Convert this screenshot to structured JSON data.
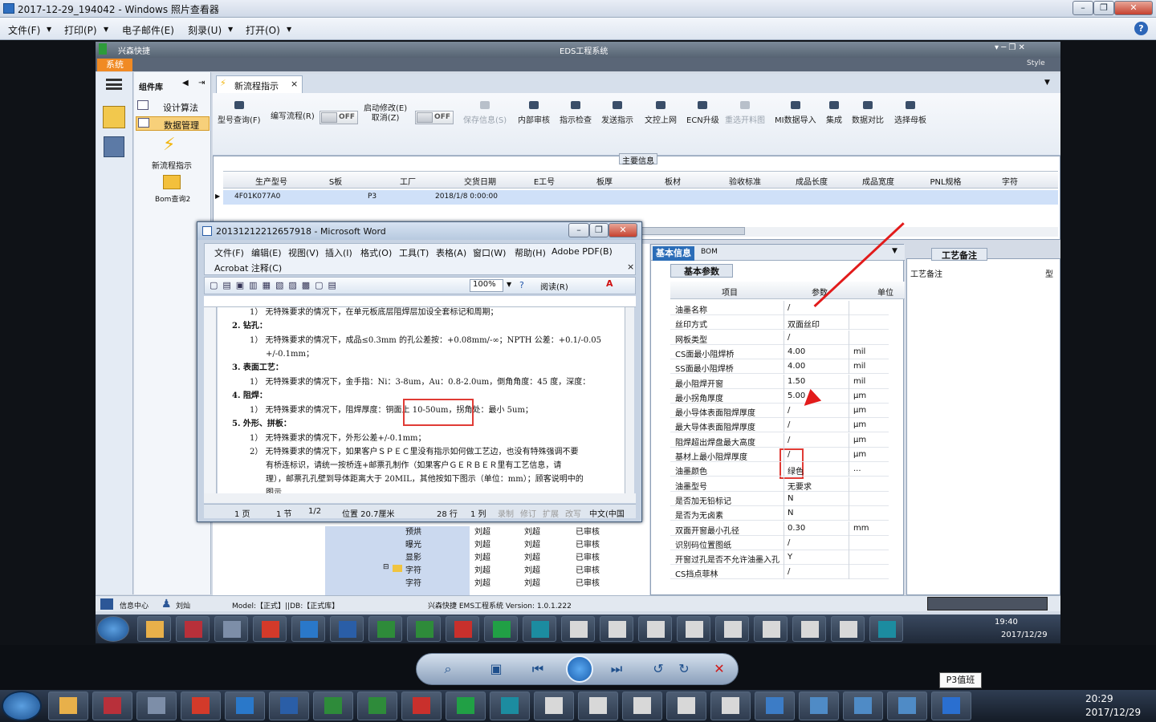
{
  "viewer": {
    "title": "2017-12-29_194042 - Windows 照片查看器",
    "menu": [
      "文件(F)",
      "打印(P)",
      "电子邮件(E)",
      "刻录(U)",
      "打开(O)"
    ],
    "help": "?"
  },
  "eds": {
    "logo_text": "兴森快捷",
    "title": "EDS工程系统",
    "style_label": "Style",
    "sys_tab": "系统",
    "nav_header": "组件库",
    "nav_items": [
      "设计算法",
      "数据管理",
      "新流程指示",
      "Bom查询2"
    ],
    "doc_tab": "新流程指示",
    "toolbar": {
      "query": "型号查询(F)",
      "write_flow": "编写流程(R)",
      "toggle_off": "OFF",
      "start_modify": "启动修改(E)",
      "cancel": "取消(Z)",
      "save_info": "保存信息(S)",
      "internal_review": "内部审核",
      "guide_check": "指示检查",
      "send_guide": "发送指示",
      "upload_doc": "文控上网",
      "ecn_upgrade": "ECN升级",
      "redo_panel": "重选开料图",
      "mi_import": "MI数据导入",
      "integrate": "集成",
      "data_compare": "数据对比",
      "choose_mother": "选择母板"
    },
    "grid": {
      "caption": "主要信息",
      "headers": [
        "生产型号",
        "S板",
        "工厂",
        "交货日期",
        "E工号",
        "板厚",
        "板材",
        "验收标准",
        "成品长度",
        "成品宽度",
        "PNL规格",
        "字符"
      ],
      "row": [
        "4F01K077A0",
        "",
        "P3",
        "2018/1/8 0:00:00",
        "",
        "",
        "",
        "",
        "",
        "",
        "",
        ""
      ]
    },
    "tree": [
      {
        "name": "预烘",
        "a": "刘超",
        "b": "刘超",
        "c": "已审核"
      },
      {
        "name": "曝光",
        "a": "刘超",
        "b": "刘超",
        "c": "已审核"
      },
      {
        "name": "显影",
        "a": "刘超",
        "b": "刘超",
        "c": "已审核"
      },
      {
        "name": "字符",
        "a": "刘超",
        "b": "刘超",
        "c": "已审核"
      },
      {
        "name": "字符",
        "a": "刘超",
        "b": "刘超",
        "c": "已审核"
      }
    ],
    "info": {
      "tab_basic": "基本信息",
      "tab_bom": "BOM",
      "sub_tab": "基本参数",
      "col_item": "项目",
      "col_param": "参数",
      "col_unit": "单位",
      "rows": [
        {
          "k": "油墨名称",
          "v": "/",
          "u": ""
        },
        {
          "k": "丝印方式",
          "v": "双面丝印",
          "u": ""
        },
        {
          "k": "网板类型",
          "v": "/",
          "u": ""
        },
        {
          "k": "CS面最小阻焊桥",
          "v": "4.00",
          "u": "mil"
        },
        {
          "k": "SS面最小阻焊桥",
          "v": "4.00",
          "u": "mil"
        },
        {
          "k": "最小阻焊开窗",
          "v": "1.50",
          "u": "mil"
        },
        {
          "k": "最小拐角厚度",
          "v": "5.00",
          "u": "μm"
        },
        {
          "k": "最小导体表面阻焊厚度",
          "v": "/",
          "u": "μm"
        },
        {
          "k": "最大导体表面阻焊厚度",
          "v": "/",
          "u": "μm"
        },
        {
          "k": "阻焊超出焊盘最大高度",
          "v": "/",
          "u": "μm"
        },
        {
          "k": "基材上最小阻焊厚度",
          "v": "/",
          "u": "μm"
        },
        {
          "k": "油墨颜色",
          "v": "绿色",
          "u": "..."
        },
        {
          "k": "油墨型号",
          "v": "无要求",
          "u": ""
        },
        {
          "k": "是否加无铅标记",
          "v": "N",
          "u": ""
        },
        {
          "k": "是否为无卤素",
          "v": "N",
          "u": ""
        },
        {
          "k": "双面开窗最小孔径",
          "v": "0.30",
          "u": "mm"
        },
        {
          "k": "识别码位置图纸",
          "v": "/",
          "u": ""
        },
        {
          "k": "开窗过孔是否不允许油墨入孔",
          "v": "Y",
          "u": ""
        },
        {
          "k": "CS挡点菲林",
          "v": "/",
          "u": ""
        }
      ]
    },
    "remark": {
      "tab": "工艺备注",
      "label": "工艺备注",
      "side": "型"
    },
    "status": {
      "info_center": "信息中心",
      "user": "刘灿",
      "model": "Model:【正式】||DB:【正式库】",
      "app": "兴森快捷 EMS工程系统 Version: 1.0.1.222"
    }
  },
  "word": {
    "title": "20131212212657918 - Microsoft Word",
    "menu": [
      "文件(F)",
      "编辑(E)",
      "视图(V)",
      "插入(I)",
      "格式(O)",
      "工具(T)",
      "表格(A)",
      "窗口(W)",
      "帮助(H)",
      "Adobe PDF(B)"
    ],
    "acrobat": "Acrobat 注释(C)",
    "zoom": "100%",
    "read": "阅读(R)",
    "lines": [
      "1） 无特殊要求的情况下，在单元板底层阻焊层加设全套标记和周期；",
      "2.  钻孔：",
      "1） 无特殊要求的情况下，成品≤0.3mm 的孔公差按：+0.08mm/-∞；NPTH 公差：+0.1/-0.05",
      "+/-0.1mm；",
      "3.  表面工艺：",
      "1） 无特殊要求的情况下，金手指：Ni：3-8um，Au：0.8-2.0um，倒角角度：45 度，深度：",
      "4.  阻焊：",
      "1） 无特殊要求的情况下，阻焊厚度：铜面上 10-50um，拐角处：最小 5um；",
      "5.  外形、拼板：",
      "1） 无特殊要求的情况下，外形公差+/-0.1mm；",
      "2） 无特殊要求的情况下，如果客户ＳＰＥＣ里没有指示如何做工艺边，也没有特殊强调不要",
      "有桥连标识，请统一按桥连+邮票孔制作（如果客户ＧＥＲＢＥＲ里有工艺信息，请",
      "理），邮票孔孔壁到导体距离大于 20MIL，其他按如下图示（单位：mm）；顾客说明中的",
      "图示"
    ],
    "status": {
      "page": "1 页",
      "section": "1 节",
      "count": "1/2",
      "pos": "位置 20.7厘米",
      "line": "28 行",
      "col": "1 列",
      "rec": "录制",
      "rev": "修订",
      "ext": "扩展",
      "ovr": "改写",
      "lang": "中文(中国"
    }
  },
  "inner_clock": {
    "time": "19:40",
    "date": "2017/12/29"
  },
  "outer_clock": {
    "time": "20:29",
    "date": "2017/12/29"
  },
  "tooltip": "P3值班",
  "colors": {
    "accent": "#2b6db8",
    "sys": "#f08a24",
    "red": "#e03b35"
  }
}
